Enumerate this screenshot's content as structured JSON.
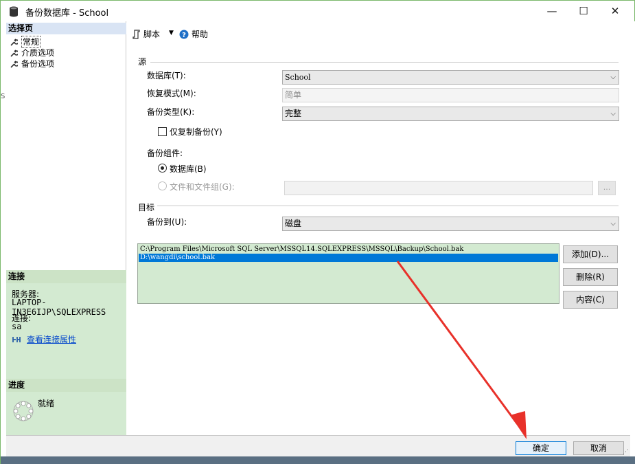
{
  "window": {
    "title": "备份数据库 - School",
    "controls": {
      "minimize": "—",
      "maximize": "☐",
      "close": "✕"
    },
    "edge_mark": "S"
  },
  "left_panel": {
    "select_page_header": "选择页",
    "pages": [
      {
        "label": "常规",
        "selected": true
      },
      {
        "label": "介质选项",
        "selected": false
      },
      {
        "label": "备份选项",
        "selected": false
      }
    ],
    "connection": {
      "header": "连接",
      "server_label": "服务器:",
      "server_value": "LAPTOP-IN3E6IJP\\SQLEXPRESS",
      "connection_label": "连接:",
      "connection_value": "sa",
      "view_props_link": "查看连接属性"
    },
    "progress": {
      "header": "进度",
      "status": "就绪"
    }
  },
  "toolbar": {
    "script_label": "脚本",
    "script_arrow": "▼",
    "help_label": "帮助"
  },
  "source": {
    "section_label": "源",
    "database_label": "数据库(T):",
    "database_value": "School",
    "recovery_label": "恢复模式(M):",
    "recovery_value": "简单",
    "backup_type_label": "备份类型(K):",
    "backup_type_value": "完整",
    "copy_only_label": "仅复制备份(Y)",
    "copy_only_checked": false,
    "component_label": "备份组件:",
    "component_database_label": "数据库(B)",
    "component_files_label": "文件和文件组(G):",
    "files_browse_label": "..."
  },
  "destination": {
    "section_label": "目标",
    "backup_to_label": "备份到(U):",
    "backup_to_value": "磁盘",
    "paths": [
      "C:\\Program Files\\Microsoft SQL Server\\MSSQL14.SQLEXPRESS\\MSSQL\\Backup\\School.bak",
      "D:\\wangdi\\school.bak"
    ],
    "selected_index": 1,
    "add_button": "添加(D)...",
    "remove_button": "删除(R)",
    "contents_button": "内容(C)"
  },
  "footer": {
    "ok_button": "确定",
    "cancel_button": "取消"
  },
  "colors": {
    "selection_blue": "#0078d7",
    "panel_green": "#d3ead1",
    "annotation_red": "#e8312a"
  }
}
